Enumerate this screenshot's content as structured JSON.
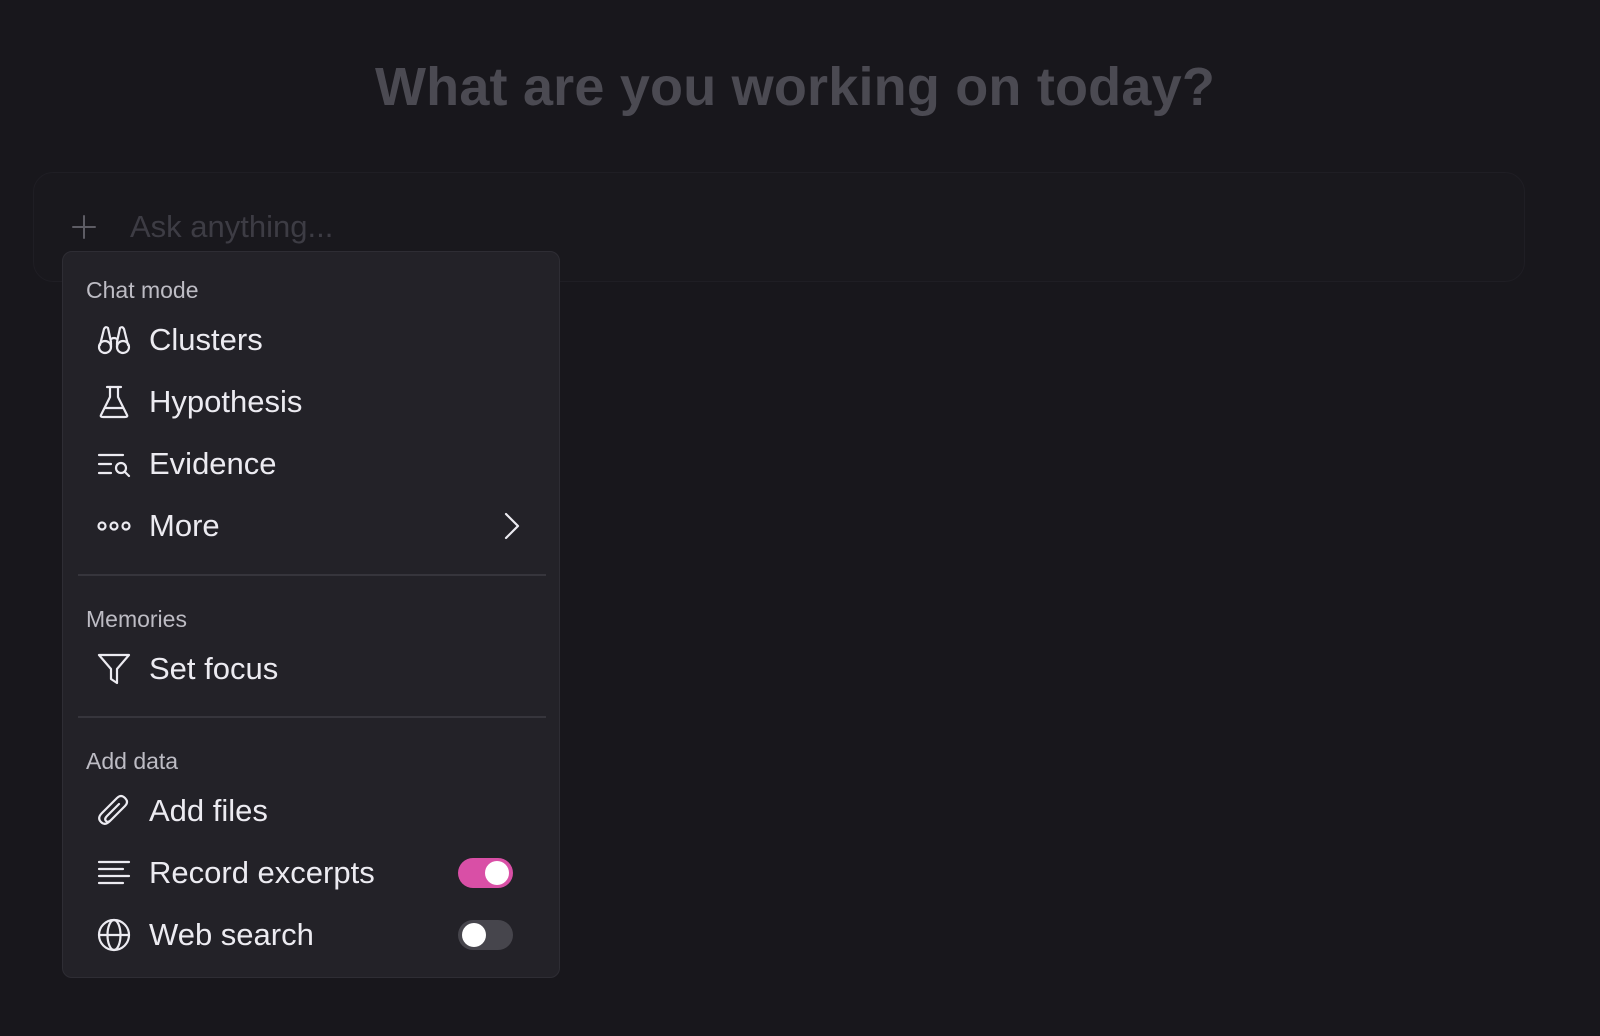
{
  "header": {
    "title": "What are you working on today?"
  },
  "chat": {
    "placeholder": "Ask anything...",
    "value": ""
  },
  "menu": {
    "sections": [
      {
        "label": "Chat mode",
        "items": [
          {
            "label": "Clusters",
            "icon": "binoculars-icon"
          },
          {
            "label": "Hypothesis",
            "icon": "flask-icon"
          },
          {
            "label": "Evidence",
            "icon": "list-search-icon"
          },
          {
            "label": "More",
            "icon": "dots-icon",
            "has_submenu": true
          }
        ]
      },
      {
        "label": "Memories",
        "items": [
          {
            "label": "Set focus",
            "icon": "filter-icon"
          }
        ]
      },
      {
        "label": "Add data",
        "items": [
          {
            "label": "Add files",
            "icon": "paperclip-icon"
          },
          {
            "label": "Record excerpts",
            "icon": "text-lines-icon",
            "toggle": true,
            "enabled": true
          },
          {
            "label": "Web search",
            "icon": "globe-icon",
            "toggle": true,
            "enabled": false
          }
        ]
      }
    ]
  },
  "colors": {
    "background": "#18171c",
    "menu_background": "#232228",
    "accent": "#d94fa6",
    "heading_text": "#4b4a52"
  }
}
